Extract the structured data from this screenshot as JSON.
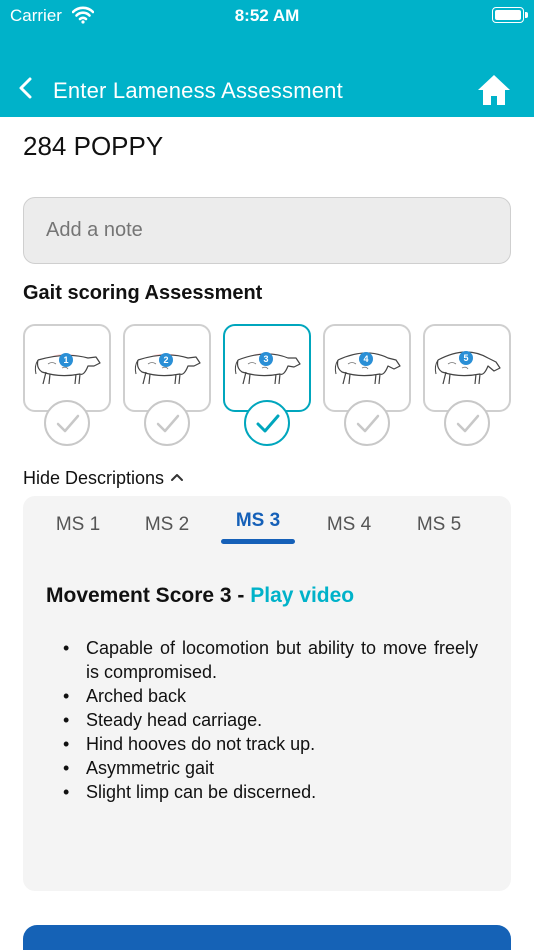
{
  "status_bar": {
    "carrier": "Carrier",
    "time": "8:52 AM"
  },
  "nav": {
    "title": "Enter Lameness Assessment",
    "back_icon": "chevron-left-icon",
    "home_icon": "home-icon"
  },
  "animal": {
    "name": "284 POPPY"
  },
  "note": {
    "placeholder": "Add a note"
  },
  "gait": {
    "title": "Gait scoring Assessment",
    "selected_score": 3,
    "cards": [
      {
        "score": "1"
      },
      {
        "score": "2"
      },
      {
        "score": "3"
      },
      {
        "score": "4"
      },
      {
        "score": "5"
      }
    ]
  },
  "descriptions": {
    "toggle_label": "Hide Descriptions",
    "tabs": [
      "MS 1",
      "MS 2",
      "MS 3",
      "MS 4",
      "MS 5"
    ],
    "active_tab": "MS 3",
    "heading": "Movement Score 3 - ",
    "play_video": "Play video",
    "bullets": [
      "Capable of locomotion but ability to move freely is compromised.",
      "Arched back",
      "Steady head carriage.",
      "Hind hooves do not track up.",
      "Asymmetric gait",
      "Slight limp can be discerned."
    ]
  },
  "colors": {
    "accent": "#00b2c9",
    "primary": "#1562b6",
    "selected_border": "#00a6bd"
  }
}
